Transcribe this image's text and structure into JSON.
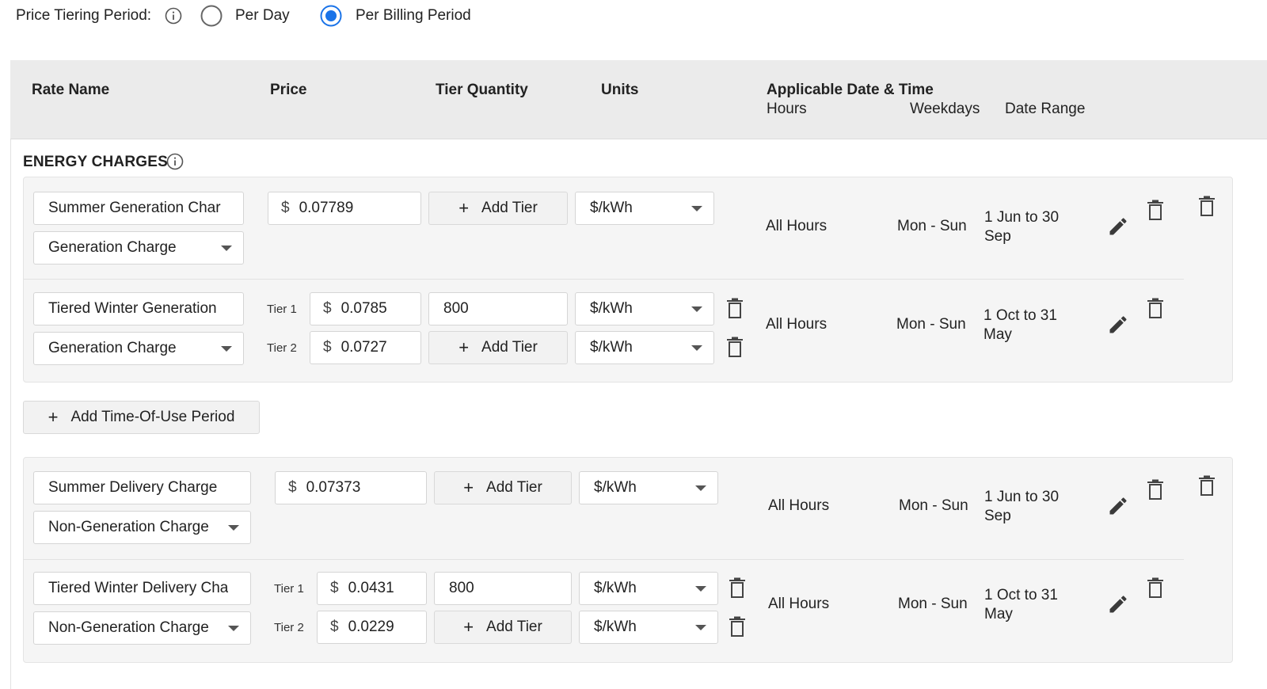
{
  "tiering": {
    "label": "Price Tiering Period:",
    "options": [
      {
        "label": "Per Day",
        "selected": false
      },
      {
        "label": "Per Billing Period",
        "selected": true
      }
    ]
  },
  "accent_color": "#1a73e8",
  "columns": {
    "rate_name": "Rate Name",
    "price": "Price",
    "tier_quantity": "Tier Quantity",
    "units": "Units",
    "applicable": "Applicable Date & Time",
    "hours": "Hours",
    "weekdays": "Weekdays",
    "date_range": "Date Range"
  },
  "section": {
    "title": "ENERGY CHARGES"
  },
  "groups": [
    {
      "rows": [
        {
          "name": "Summer Generation Char",
          "type": "Generation Charge",
          "price": "0.07789",
          "add_tier": "Add Tier",
          "unit": "$/kWh",
          "hours": "All Hours",
          "weekdays": "Mon - Sun",
          "date_range_1": "1 Jun to 30",
          "date_range_2": "Sep"
        },
        {
          "name": "Tiered Winter Generation",
          "type": "Generation Charge",
          "tier1_label": "Tier 1",
          "tier1_price": "0.0785",
          "tier1_qty": "800",
          "tier1_unit": "$/kWh",
          "tier2_label": "Tier 2",
          "tier2_price": "0.0727",
          "add_tier": "Add Tier",
          "tier2_unit": "$/kWh",
          "hours": "All Hours",
          "weekdays": "Mon - Sun",
          "date_range_1": "1 Oct to 31",
          "date_range_2": "May"
        }
      ]
    },
    {
      "rows": [
        {
          "name": "Summer Delivery Charge",
          "type": "Non-Generation Charge",
          "price": "0.07373",
          "add_tier": "Add Tier",
          "unit": "$/kWh",
          "hours": "All Hours",
          "weekdays": "Mon - Sun",
          "date_range_1": "1 Jun to 30",
          "date_range_2": "Sep"
        },
        {
          "name": "Tiered Winter Delivery Cha",
          "type": "Non-Generation Charge",
          "tier1_label": "Tier 1",
          "tier1_price": "0.0431",
          "tier1_qty": "800",
          "tier1_unit": "$/kWh",
          "tier2_label": "Tier 2",
          "tier2_price": "0.0229",
          "add_tier": "Add Tier",
          "tier2_unit": "$/kWh",
          "hours": "All Hours",
          "weekdays": "Mon - Sun",
          "date_range_1": "1 Oct to 31",
          "date_range_2": "May"
        }
      ]
    }
  ],
  "add_tou": "Add Time-Of-Use Period",
  "currency_symbol": "$"
}
